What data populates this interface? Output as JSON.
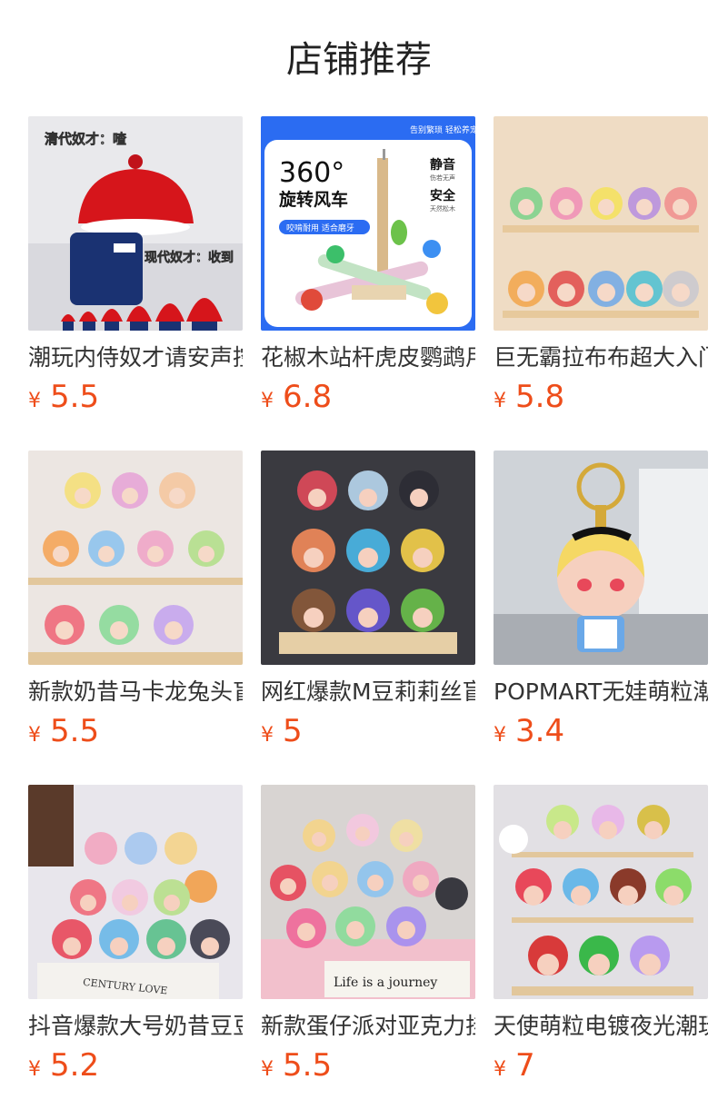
{
  "section": {
    "title": "店铺推荐"
  },
  "currency_symbol": "¥",
  "accent_color": "#ee4d1a",
  "products": [
    {
      "name": "潮玩内侍奴才请安声控",
      "price": "5.5",
      "image_texts": [
        "清代奴才：喳",
        "现代奴才：收到"
      ]
    },
    {
      "name": "花椒木站杆虎皮鹦鹉用品",
      "price": "6.8",
      "image_texts": [
        "告别繁琐 轻松养宠",
        "360°",
        "旋转风车",
        "静音",
        "伤若无声",
        "安全",
        "天然松木",
        "咬啃耐用 适合磨牙"
      ]
    },
    {
      "name": "巨无霸拉布布超大入门款",
      "price": "5.8",
      "image_texts": []
    },
    {
      "name": "新款奶昔马卡龙兔头盲盒",
      "price": "5.5",
      "image_texts": []
    },
    {
      "name": "网红爆款M豆莉莉丝盲盒",
      "price": "5",
      "image_texts": []
    },
    {
      "name": "POPMART无娃萌粒潮玩",
      "price": "3.4",
      "image_texts": []
    },
    {
      "name": "抖音爆款大号奶昔豆豆盲盒",
      "price": "5.2",
      "image_texts": [
        "CENTURY LOVE"
      ]
    },
    {
      "name": "新款蛋仔派对亚克力挂件",
      "price": "5.5",
      "image_texts": [
        "Life is a journey"
      ]
    },
    {
      "name": "天使萌粒电镀夜光潮玩",
      "price": "7",
      "image_texts": []
    }
  ]
}
